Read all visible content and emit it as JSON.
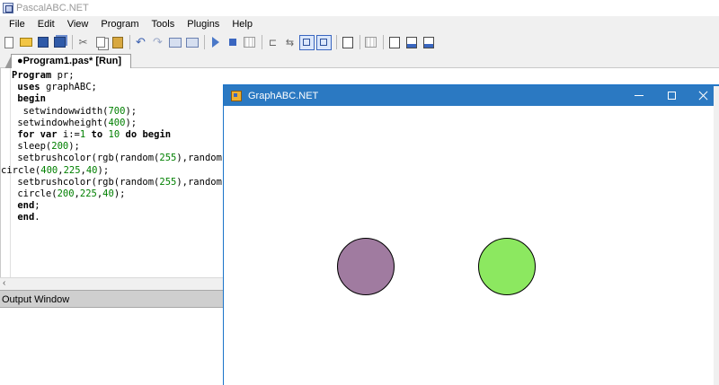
{
  "ide": {
    "title": "PascalABC.NET",
    "menu": [
      "File",
      "Edit",
      "View",
      "Program",
      "Tools",
      "Plugins",
      "Help"
    ]
  },
  "toolbar": {
    "icons": [
      "new-file-icon",
      "open-folder-icon",
      "save-icon",
      "save-all-icon",
      "cut-icon",
      "copy-icon",
      "paste-icon",
      "undo-icon",
      "redo-icon",
      "navigate-back-icon",
      "navigate-forward-icon",
      "run-icon",
      "stop-icon",
      "debug-grid-icon",
      "comment-icon",
      "uncomment-icon",
      "toggle-output-icon",
      "toggle-panel-icon",
      "format-icon",
      "grid-view-icon",
      "document-icon",
      "document-export-icon",
      "document-save-icon"
    ]
  },
  "tab": {
    "label": "●Program1.pas* [Run]"
  },
  "code": [
    {
      "text": "Program pr;",
      "indent": 0
    },
    {
      "text": " uses graphABC;",
      "indent": 0
    },
    {
      "text": " begin",
      "indent": 0
    },
    {
      "text": "  setwindowwidth(700);",
      "indent": 0
    },
    {
      "text": " setwindowheight(400);",
      "indent": 0
    },
    {
      "text": " for var i:=1 to 10 do begin",
      "indent": 0
    },
    {
      "text": " sleep(200);",
      "indent": 0
    },
    {
      "text": " setbrushcolor(rgb(random(255),random",
      "indent": 0
    },
    {
      "text": "circle(400,225,40);",
      "indent": -1
    },
    {
      "text": " setbrushcolor(rgb(random(255),random",
      "indent": 0
    },
    {
      "text": " circle(200,225,40);",
      "indent": 0
    },
    {
      "text": " end;",
      "indent": 0
    },
    {
      "text": " end.",
      "indent": 0
    }
  ],
  "output": {
    "header": "Output Window"
  },
  "graph_window": {
    "title": "GraphABC.NET",
    "circles": [
      {
        "name": "left-circle",
        "fill": "#a07ba0"
      },
      {
        "name": "right-circle",
        "fill": "#8ce860"
      }
    ]
  },
  "colors": {
    "graph_titlebar": "#2b79c2",
    "code_number": "#008000"
  }
}
